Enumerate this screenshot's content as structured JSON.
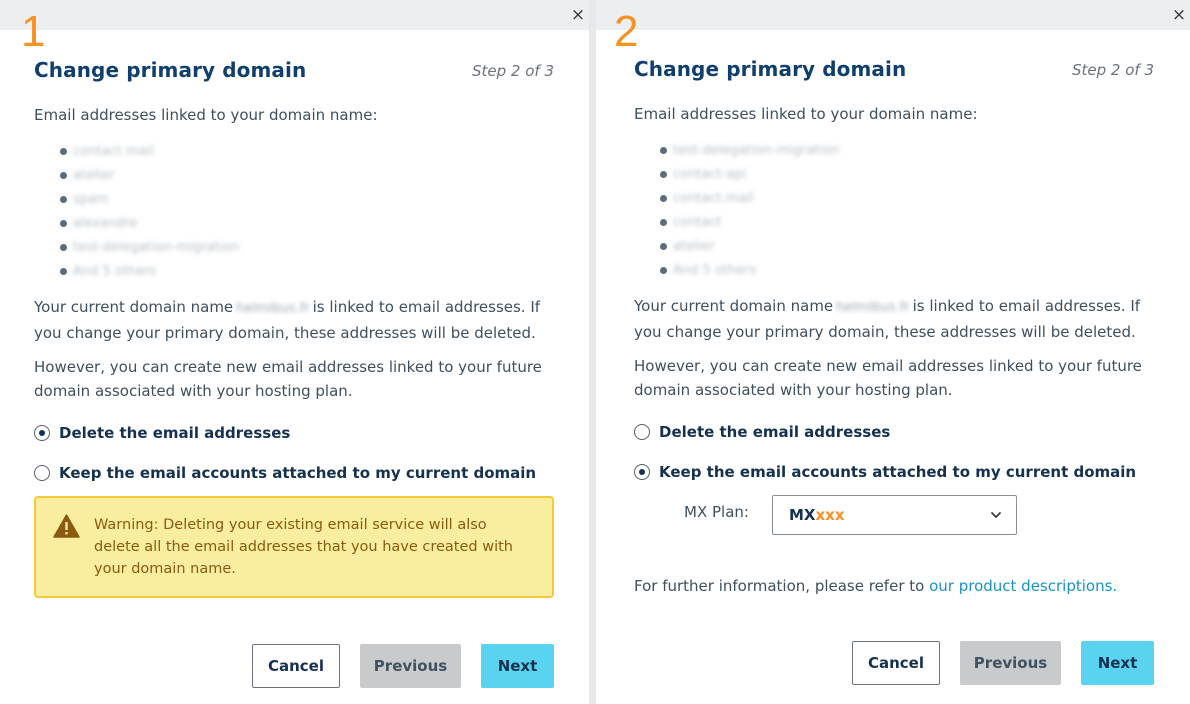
{
  "panel1": {
    "number": "1",
    "close_icon": "×",
    "title": "Change primary domain",
    "step": "Step 2 of 3",
    "intro": "Email addresses linked to your domain name:",
    "emails": [
      "contact.mail",
      "atelier",
      "spam",
      "alexandre",
      "test-delegation-migration",
      "And 5 others"
    ],
    "domain_sentence_pre": "Your current domain name",
    "domain_blurred": "helmibus.fr",
    "domain_sentence_post": "is linked to email addresses. If you change your primary domain, these addresses will be deleted.",
    "however": "However, you can create new email addresses linked to your future domain associated with your hosting plan.",
    "option_delete": "Delete the email addresses",
    "option_keep": "Keep the email accounts attached to my current domain",
    "selected": "delete",
    "warning": "Warning: Deleting your existing email service will also delete all the email addresses that you have created with your domain name.",
    "cancel": "Cancel",
    "previous": "Previous",
    "next": "Next"
  },
  "panel2": {
    "number": "2",
    "close_icon": "×",
    "title": "Change primary domain",
    "step": "Step 2 of 3",
    "intro": "Email addresses linked to your domain name:",
    "emails": [
      "test-delegation-migration",
      "contact-api",
      "contact.mail",
      "contact",
      "atelier",
      "And 5 others"
    ],
    "domain_sentence_pre": "Your current domain name",
    "domain_blurred": "helmibus.fr",
    "domain_sentence_post": "is linked to email addresses. If you change your primary domain, these addresses will be deleted.",
    "however": "However, you can create new email addresses linked to your future domain associated with your hosting plan.",
    "option_delete": "Delete the email addresses",
    "option_keep": "Keep the email accounts attached to my current domain",
    "selected": "keep",
    "mx_label": "MX Plan:",
    "mx_value_main": "MX",
    "mx_value_accent": "xxx",
    "further_pre": "For further information, please refer to",
    "further_link": "our product descriptions.",
    "cancel": "Cancel",
    "previous": "Previous",
    "next": "Next"
  },
  "colors": {
    "accent_orange": "#f79124",
    "title_blue": "#113f6d",
    "next_button": "#5ad3f0",
    "warning_bg": "#f9eda0",
    "link": "#1793c4"
  }
}
